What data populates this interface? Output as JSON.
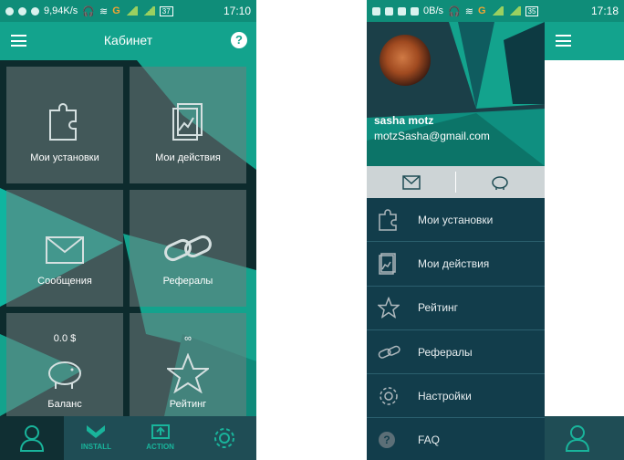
{
  "left": {
    "status": {
      "speed": "9,94K/s",
      "network": "G",
      "battery": "37",
      "time": "17:10"
    },
    "appbar": {
      "title": "Кабинет",
      "help": "?"
    },
    "tiles": [
      {
        "label": "Мои установки",
        "icon": "puzzle-icon"
      },
      {
        "label": "Мои действия",
        "icon": "chart-document-icon"
      },
      {
        "label": "Сообщения",
        "icon": "envelope-icon"
      },
      {
        "label": "Рефералы",
        "icon": "link-icon"
      },
      {
        "label": "Баланс",
        "top": "0.0 $",
        "icon": "piggy-bank-icon"
      },
      {
        "label": "Рейтинг",
        "top": "∞",
        "icon": "star-icon"
      }
    ],
    "bottom_nav": [
      {
        "label": "",
        "icon": "user-icon",
        "active": true
      },
      {
        "label": "INSTALL",
        "icon": "install-icon"
      },
      {
        "label": "ACTION",
        "icon": "action-icon"
      },
      {
        "label": "",
        "icon": "gear-icon"
      }
    ]
  },
  "right": {
    "status": {
      "speed": "0B/s",
      "network": "G",
      "battery": "35",
      "time": "17:18"
    },
    "user": {
      "name": "sasha  motz",
      "email": "motzSasha@gmail.com"
    },
    "drawer_tabs": [
      {
        "icon": "envelope-icon"
      },
      {
        "icon": "piggy-bank-icon"
      }
    ],
    "menu": [
      {
        "label": "Мои установки",
        "icon": "puzzle-icon"
      },
      {
        "label": "Мои действия",
        "icon": "chart-document-icon"
      },
      {
        "label": "Рейтинг",
        "icon": "star-icon"
      },
      {
        "label": "Рефералы",
        "icon": "link-icon"
      },
      {
        "label": "Настройки",
        "icon": "gear-icon"
      },
      {
        "label": "FAQ",
        "icon": "help-icon"
      }
    ]
  },
  "colors": {
    "primary": "#13a38d",
    "status": "#0f8d79",
    "dark": "#1f4d55",
    "drawer": "#123d4b"
  }
}
